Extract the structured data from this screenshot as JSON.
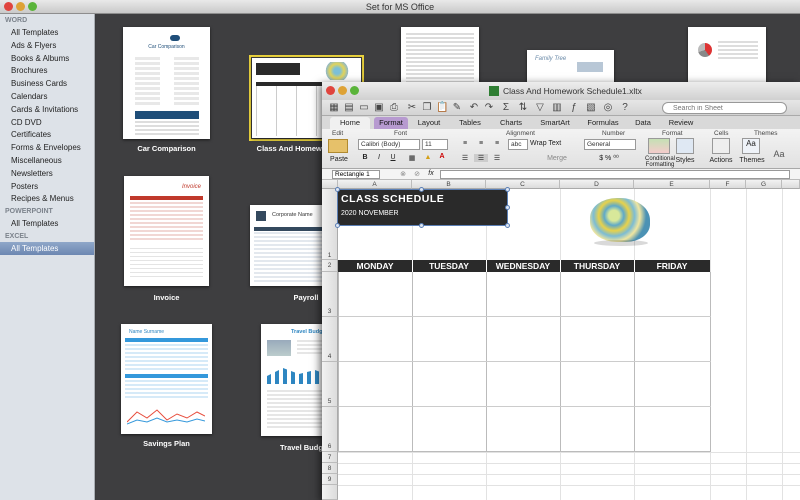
{
  "window": {
    "title": "Set for MS Office"
  },
  "sidebar": {
    "sections": [
      {
        "heading": "WORD",
        "items": [
          "All Templates",
          "Ads & Flyers",
          "Books & Albums",
          "Brochures",
          "Business Cards",
          "Calendars",
          "Cards & Invitations",
          "CD DVD",
          "Certificates",
          "Forms & Envelopes",
          "Miscellaneous",
          "Newsletters",
          "Posters",
          "Recipes & Menus"
        ]
      },
      {
        "heading": "POWERPOINT",
        "items": [
          "All Templates"
        ]
      },
      {
        "heading": "EXCEL",
        "items": [
          "All Templates"
        ]
      }
    ],
    "selected": "EXCEL / All Templates"
  },
  "templates": [
    {
      "label": "Car Comparison",
      "thumb_title": "Car Comparison"
    },
    {
      "label": "Class And Homewor"
    },
    {
      "label": "",
      "thumb_title": ""
    },
    {
      "label": "",
      "thumb_title": "Family Tree"
    },
    {
      "label": ""
    },
    {
      "label": "Invoice",
      "thumb_title": "Invoice"
    },
    {
      "label": "Payroll",
      "thumb_title": "Corporate Name"
    },
    {
      "label": "Savings Plan",
      "thumb_title": "Name Surname"
    },
    {
      "label": "Travel Budg",
      "thumb_title": "Travel Budget"
    }
  ],
  "excel": {
    "title": "Class And Homework Schedule1.xltx",
    "search_placeholder": "Search in Sheet",
    "ribbon_tabs": [
      "Home",
      "Format",
      "Layout",
      "Tables",
      "Charts",
      "SmartArt",
      "Formulas",
      "Data",
      "Review"
    ],
    "active_tab": "Home",
    "groups": {
      "edit": "Edit",
      "font": "Font",
      "alignment": "Alignment",
      "number": "Number",
      "format": "Format",
      "cells": "Cells",
      "themes": "Themes"
    },
    "font_name": "Calibri (Body)",
    "font_size": "11",
    "number_format": "General",
    "wrap_text": "Wrap Text",
    "merge": "Merge",
    "paste": "Paste",
    "conditional": "Conditional Formatting",
    "styles": "Styles",
    "actions": "Actions",
    "themes_btn": "Themes",
    "name_box": "Rectangle 1",
    "fx": "fx",
    "columns": [
      "A",
      "B",
      "C",
      "D",
      "E",
      "F",
      "G"
    ],
    "rows": [
      "1",
      "2",
      "3",
      "4",
      "5",
      "6",
      "7",
      "8",
      "9"
    ],
    "schedule": {
      "title": "CLASS SCHEDULE",
      "subtitle": "2020 NOVEMBER",
      "days": [
        "MONDAY",
        "TUESDAY",
        "WEDNESDAY",
        "THURSDAY",
        "FRIDAY"
      ]
    }
  },
  "colors": {
    "sidebar_selected": "#6c87b1",
    "selection_border": "#e9d23d",
    "dark_band": "#2a2a2a"
  }
}
